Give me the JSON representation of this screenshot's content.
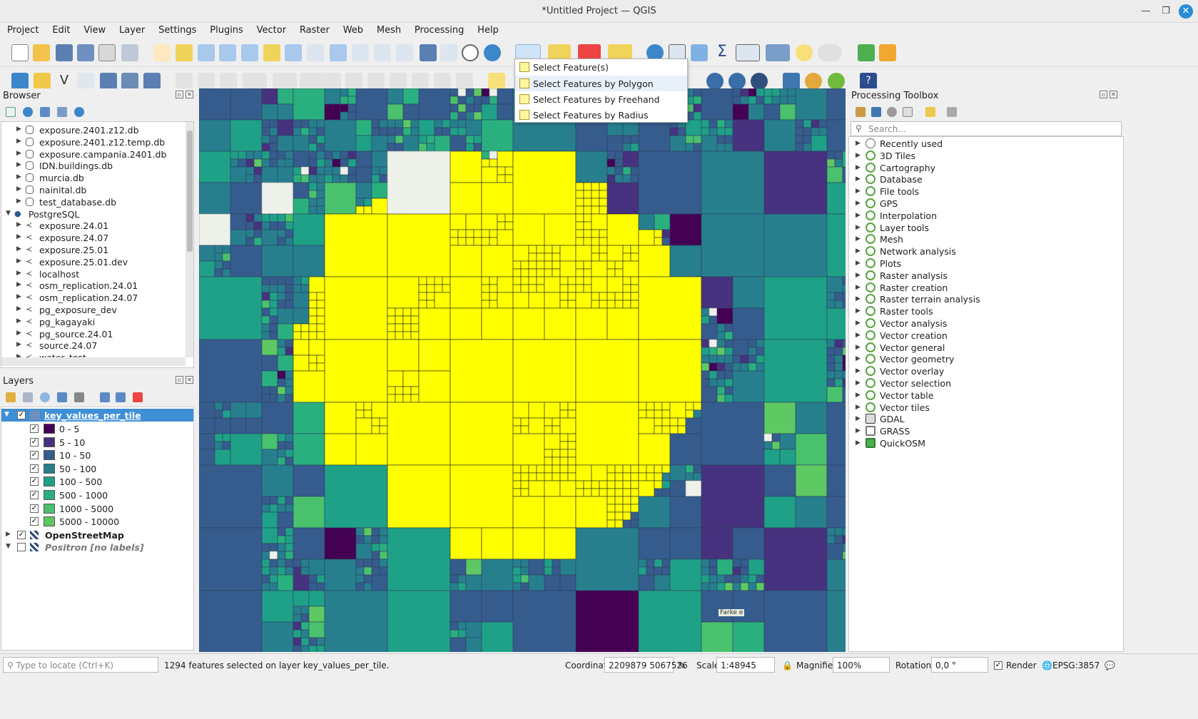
{
  "window": {
    "title": "*Untitled Project — QGIS"
  },
  "menu": [
    "Project",
    "Edit",
    "View",
    "Layer",
    "Settings",
    "Plugins",
    "Vector",
    "Raster",
    "Web",
    "Mesh",
    "Processing",
    "Help"
  ],
  "select_menu": {
    "items": [
      "Select Feature(s)",
      "Select Features by Polygon",
      "Select Features by Freehand",
      "Select Features by Radius"
    ],
    "highlighted": "Select Features by Polygon"
  },
  "browser": {
    "title": "Browser",
    "items": [
      {
        "label": "exposure.2401.z12.db",
        "type": "db"
      },
      {
        "label": "exposure.2401.z12.temp.db",
        "type": "db"
      },
      {
        "label": "exposure.campania.2401.db",
        "type": "db"
      },
      {
        "label": "IDN.buildings.db",
        "type": "db"
      },
      {
        "label": "murcia.db",
        "type": "db"
      },
      {
        "label": "nainital.db",
        "type": "db"
      },
      {
        "label": "test_database.db",
        "type": "db"
      },
      {
        "label": "PostgreSQL",
        "type": "pg-root"
      },
      {
        "label": "exposure.24.01",
        "type": "pg"
      },
      {
        "label": "exposure.24.07",
        "type": "pg"
      },
      {
        "label": "exposure.25.01",
        "type": "pg"
      },
      {
        "label": "exposure.25.01.dev",
        "type": "pg"
      },
      {
        "label": "localhost",
        "type": "pg"
      },
      {
        "label": "osm_replication.24.01",
        "type": "pg"
      },
      {
        "label": "osm_replication.24.07",
        "type": "pg"
      },
      {
        "label": "pg_exposure_dev",
        "type": "pg"
      },
      {
        "label": "pg_kagayaki",
        "type": "pg"
      },
      {
        "label": "pg_source.24.01",
        "type": "pg"
      },
      {
        "label": "source.24.07",
        "type": "pg"
      },
      {
        "label": "water_test",
        "type": "pg"
      }
    ]
  },
  "layers": {
    "title": "Layers",
    "main_layer": "key_values_per_tile",
    "classes": [
      {
        "label": "0 - 5",
        "color": "#440154"
      },
      {
        "label": "5 - 10",
        "color": "#46327e"
      },
      {
        "label": "10 - 50",
        "color": "#365c8d"
      },
      {
        "label": "50 - 100",
        "color": "#277f8e"
      },
      {
        "label": "100 - 500",
        "color": "#1fa187"
      },
      {
        "label": "500 - 1000",
        "color": "#2ab07f"
      },
      {
        "label": "1000 - 5000",
        "color": "#4ac16d"
      },
      {
        "label": "5000 - 10000",
        "color": "#5ec962"
      }
    ],
    "other": [
      {
        "label": "OpenStreetMap",
        "checked": true,
        "italic": false
      },
      {
        "label": "Positron [no labels]",
        "checked": false,
        "italic": true
      }
    ]
  },
  "processing": {
    "title": "Processing Toolbox",
    "search_placeholder": "Search...",
    "items": [
      "Recently used",
      "3D Tiles",
      "Cartography",
      "Database",
      "File tools",
      "GPS",
      "Interpolation",
      "Layer tools",
      "Mesh",
      "Network analysis",
      "Plots",
      "Raster analysis",
      "Raster creation",
      "Raster terrain analysis",
      "Raster tools",
      "Vector analysis",
      "Vector creation",
      "Vector general",
      "Vector geometry",
      "Vector overlay",
      "Vector selection",
      "Vector table",
      "Vector tiles",
      "GDAL",
      "GRASS",
      "QuickOSM"
    ]
  },
  "map": {
    "selection_color": "#ffff00",
    "label_1": "Farke e"
  },
  "status": {
    "locate_placeholder": "Type to locate (Ctrl+K)",
    "message": "1294 features selected on layer key_values_per_tile.",
    "coordinate_label": "Coordinate",
    "coordinate": "2209879  5067526",
    "scale_label": "Scale",
    "scale": "1:48945",
    "magnifier_label": "Magnifier",
    "magnifier": "100%",
    "rotation_label": "Rotation",
    "rotation": "0,0 °",
    "render_label": "Render",
    "crs": "EPSG:3857"
  }
}
